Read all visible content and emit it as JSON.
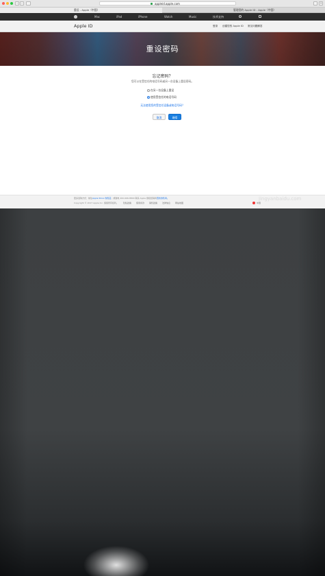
{
  "browser": {
    "url": "appleid.apple.com",
    "tabs": [
      {
        "label": "重设 - Apple（中国）",
        "active": true
      },
      {
        "label": "管理您的 Apple ID - Apple（中国）",
        "active": false
      }
    ]
  },
  "global_nav": {
    "items": [
      "Mac",
      "iPad",
      "iPhone",
      "Watch",
      "Music",
      "技术支持"
    ]
  },
  "local_nav": {
    "brand": "Apple ID",
    "links": [
      "登录",
      "创建您的 Apple ID",
      "常见问题解答"
    ]
  },
  "hero": {
    "title": "重设密码"
  },
  "main": {
    "question": "忘记密码？",
    "subtitle": "您可以在受信任的电话号码或另一台设备上重设密码。",
    "options": [
      {
        "label": "在另一台设备上重设",
        "checked": false
      },
      {
        "label": "使用受信任的电话号码",
        "checked": true
      }
    ],
    "help_link": "无法使用您的受信任设备或电话号码？",
    "cancel_label": "取消",
    "continue_label": "继续"
  },
  "footer": {
    "line1_prefix": "更多选购方式：前往",
    "line1_store": "Apple Store 零售店",
    "line1_mid": "，或致电 400-666-8800 联系 Apple 授权经销商",
    "line1_link": "查找零售商。",
    "copyright": "Copyright © 2017 Apple Inc. 保留所有权利。",
    "links": [
      "隐私政策",
      "使用条款",
      "销售政策",
      "法律信息",
      "网站地图"
    ],
    "region": "中国",
    "watermark": "jingyanbaidu.com"
  },
  "colors": {
    "accent": "#1a7fe0",
    "nav_bg": "#2d2d2d",
    "hero_text": "#ffffff"
  }
}
